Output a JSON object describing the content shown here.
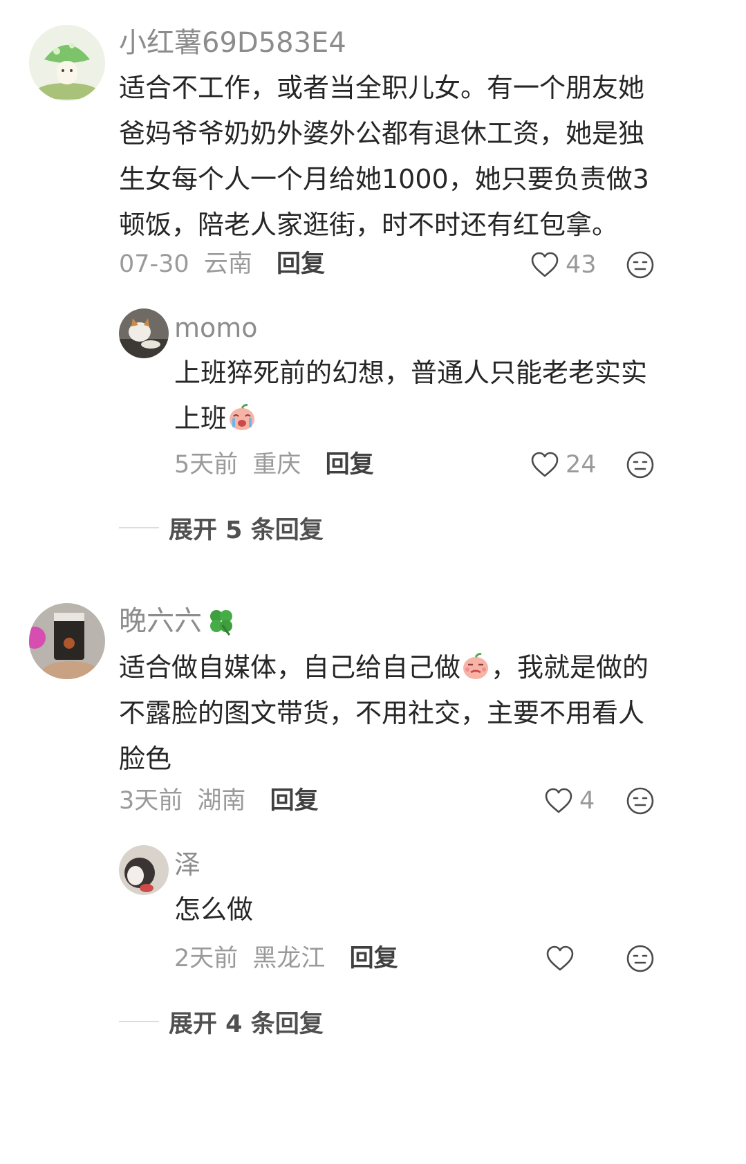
{
  "comments": [
    {
      "username": "小红薯69D583E4",
      "text_lines": [
        "适合不工作，或者当全职儿女。有一个朋友她",
        "爸妈爷爷奶奶外婆外公都有退休工资，她是独",
        "生女每个人一个月给她1000，她只要负责做3",
        "顿饭，陪老人家逛街，时不时还有红包拿。"
      ],
      "date": "07-30",
      "location": "云南",
      "reply_label": "回复",
      "likes": "43",
      "reply": {
        "username": "momo",
        "text_lines": [
          "上班猝死前的幻想，普通人只能老老实实",
          "上班"
        ],
        "date": "5天前",
        "location": "重庆",
        "reply_label": "回复",
        "likes": "24"
      },
      "expand_label": "展开 5 条回复"
    },
    {
      "username": "晚六六",
      "text_line1a": "适合做自媒体，自己给自己做",
      "text_line1b": "，我就是做的",
      "text_lines_rest": [
        "不露脸的图文带货，不用社交，主要不用看人",
        "脸色"
      ],
      "date": "3天前",
      "location": "湖南",
      "reply_label": "回复",
      "likes": "4",
      "reply": {
        "username": "泽",
        "text_lines": [
          "怎么做"
        ],
        "date": "2天前",
        "location": "黑龙江",
        "reply_label": "回复"
      },
      "expand_label": "展开 4 条回复"
    }
  ],
  "icons": {
    "like": "heart-outline-icon",
    "dislike": "neutral-face-icon",
    "username_badge": "four-leaf-clover-icon"
  },
  "colors": {
    "muted": "#9a9a9a",
    "body_text": "#262626",
    "icon_stroke": "#4a4a4a"
  }
}
